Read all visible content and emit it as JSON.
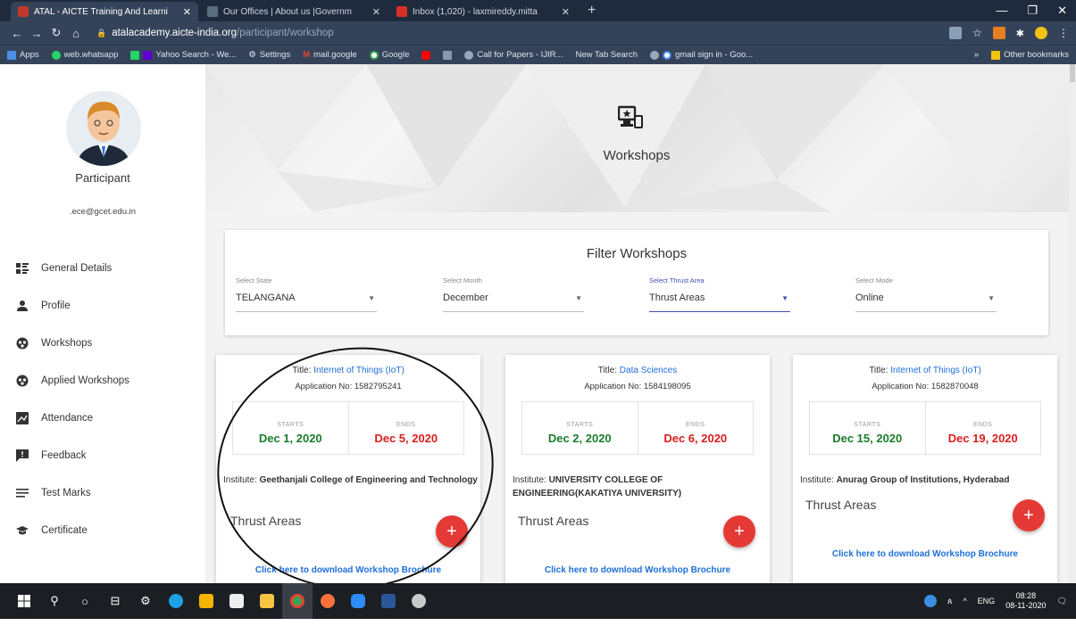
{
  "browser": {
    "tabs": [
      {
        "title": "ATAL - AICTE Training And Learni",
        "color": "#c0392b",
        "active": true
      },
      {
        "title": "Our Offices | About us |Governm",
        "color": "#5a6c7f",
        "active": false
      },
      {
        "title": "Inbox (1,020) - laxmireddy.mitta",
        "color": "#d93025",
        "active": false
      }
    ],
    "url_host": "atalacademy.aicte-india.org",
    "url_path": "/participant/workshop",
    "bookmarks": [
      "Apps",
      "web.whatsapp",
      "Yahoo Search - We...",
      "Settings",
      "mail.google",
      "Google",
      "Call for Papers - IJIR...",
      "New Tab Search",
      "gmail sign in - Goo..."
    ],
    "other_bookmarks": "Other bookmarks"
  },
  "sidebar": {
    "role": "Participant",
    "email": ".ece@gcet.edu.in",
    "items": [
      {
        "label": "General Details",
        "icon": "general-details-icon"
      },
      {
        "label": "Profile",
        "icon": "person-icon"
      },
      {
        "label": "Workshops",
        "icon": "workshops-icon"
      },
      {
        "label": "Applied Workshops",
        "icon": "applied-workshops-icon"
      },
      {
        "label": "Attendance",
        "icon": "attendance-icon"
      },
      {
        "label": "Feedback",
        "icon": "feedback-icon"
      },
      {
        "label": "Test Marks",
        "icon": "list-icon"
      },
      {
        "label": "Certificate",
        "icon": "graduation-cap-icon"
      }
    ]
  },
  "hero": {
    "title": "Workshops"
  },
  "filter": {
    "title": "Filter Workshops",
    "state": {
      "label": "Select State",
      "value": "TELANGANA"
    },
    "month": {
      "label": "Select Month",
      "value": "December"
    },
    "thrust": {
      "label": "Select Thrust Area",
      "value": "Thrust Areas"
    },
    "mode": {
      "label": "Select Mode",
      "value": "Online"
    }
  },
  "cards": [
    {
      "title_label": "Title: ",
      "title_value": "Internet of Things (IoT)",
      "app_no": "Application No: 1582795241",
      "starts_label": "STARTS",
      "start": "Dec 1, 2020",
      "ends_label": "ENDS",
      "end": "Dec 5, 2020",
      "institute_label": "Institute: ",
      "institute": "Geethanjali College of Engineering and Technology",
      "thrust": "Thrust Areas",
      "brochure": "Click here to download Workshop Brochure"
    },
    {
      "title_label": "Title: ",
      "title_value": "Data Sciences",
      "app_no": "Application No: 1584198095",
      "starts_label": "STARTS",
      "start": "Dec 2, 2020",
      "ends_label": "ENDS",
      "end": "Dec 6, 2020",
      "institute_label": "Institute: ",
      "institute": "UNIVERSITY COLLEGE OF ENGINEERING(KAKATIYA UNIVERSITY)",
      "thrust": "Thrust Areas",
      "brochure": "Click here to download Workshop Brochure"
    },
    {
      "title_label": "Title: ",
      "title_value": "Internet of Things (IoT)",
      "app_no": "Application No: 1582870048",
      "starts_label": "STARTS",
      "start": "Dec 15, 2020",
      "ends_label": "ENDS",
      "end": "Dec 19, 2020",
      "institute_label": "Institute: ",
      "institute": "Anurag Group of Institutions, Hyderabad",
      "thrust": "Thrust Areas",
      "brochure": "Click here to download Workshop Brochure"
    }
  ],
  "fab_label": "+",
  "taskbar": {
    "lang": "ENG",
    "time": "08:28",
    "date": "08-11-2020"
  },
  "colors": {
    "accent": "#3f51b5",
    "start": "#1a7d2c",
    "end": "#d81f1f",
    "link": "#1e6fd9",
    "fab": "#e53935"
  }
}
